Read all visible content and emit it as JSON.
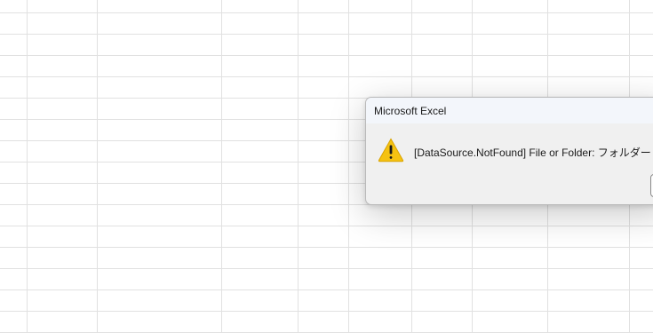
{
  "dialog": {
    "title": "Microsoft Excel",
    "message": "[DataSource.NotFound] File or Folder: フォルダー",
    "icon": "warning-icon"
  },
  "colors": {
    "gridline": "#e1e1e1",
    "dialog_bg": "#f0f0f0",
    "titlebar_bg": "#f3f6fb",
    "warning_yellow": "#f5c211"
  }
}
